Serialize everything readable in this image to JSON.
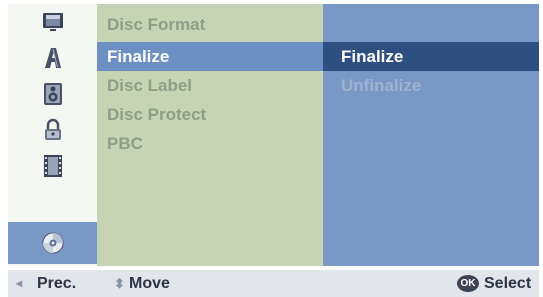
{
  "left_icons": [
    {
      "name": "tv-icon"
    },
    {
      "name": "letter-a-icon"
    },
    {
      "name": "speaker-icon"
    },
    {
      "name": "lock-icon"
    },
    {
      "name": "film-icon"
    },
    {
      "name": "disc-icon",
      "selected": true
    }
  ],
  "menu": {
    "items": [
      {
        "label": "Disc Format"
      },
      {
        "label": "Finalize",
        "active": true
      },
      {
        "label": "Disc Label"
      },
      {
        "label": "Disc Protect"
      },
      {
        "label": "PBC"
      }
    ]
  },
  "submenu": {
    "items": [
      {
        "label": "Finalize",
        "active": true
      },
      {
        "label": "Unfinalize"
      }
    ]
  },
  "footer": {
    "prev_glyph": "◂",
    "prev_label": "Prec.",
    "move_glyph": "⬍",
    "move_label": "Move",
    "ok_badge": "OK",
    "select_label": "Select"
  },
  "colors": {
    "icon_column": "#f4f7f2",
    "menu_bg": "#c6d4b3",
    "submenu_bg": "#7a98c6",
    "highlight": "#6e8fc3",
    "submenu_highlight": "#2f4f80",
    "footer_bg": "#e2e5ea"
  }
}
